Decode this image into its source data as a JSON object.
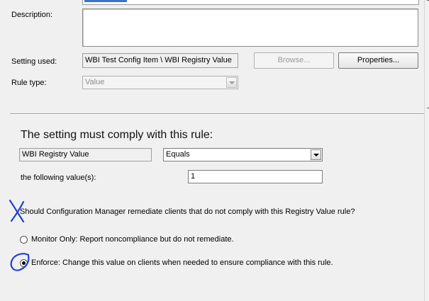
{
  "form": {
    "description_label": "Description:",
    "setting_used_label": "Setting used:",
    "setting_used_value": "WBI Test Config Item \\ WBI Registry Value",
    "browse_label": "Browse...",
    "properties_label": "Properties...",
    "rule_type_label": "Rule type:",
    "rule_type_value": "Value"
  },
  "rule": {
    "heading": "The setting must comply with this rule:",
    "setting_name": "WBI Registry Value",
    "operator": "Equals",
    "value_label": "the following value(s):",
    "value": "1"
  },
  "remediation": {
    "question": "Should Configuration Manager remediate clients that do not comply with this Registry Value rule?",
    "monitor_label": "Monitor Only: Report noncompliance but do not remediate.",
    "enforce_label": "Enforce: Change this value on clients when needed to ensure compliance with this rule.",
    "selected": "enforce"
  },
  "annotations": {
    "ink_color": "#1f3fd6"
  }
}
